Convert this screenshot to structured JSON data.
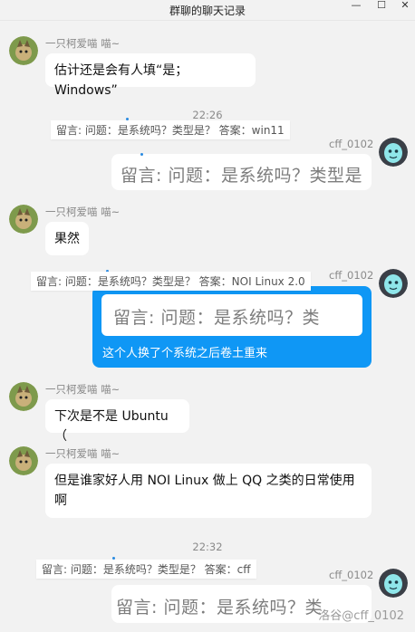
{
  "window": {
    "title": "群聊的聊天记录",
    "minimize_glyph": "—",
    "maximize_glyph": "☐",
    "close_glyph": "✕"
  },
  "users": {
    "cat_user": "一只柯爱喵 喵~",
    "cff_user": "cff_0102"
  },
  "messages": {
    "m1": "估计还是会有人填“是；Windows”",
    "time1": "22:26",
    "notice1": "留言: 问题：是系统吗？类型是？ 答案：win11",
    "m2_image_text": "留言: 问题：是系统吗？类型是",
    "m3": "果然",
    "notice2": "留言: 问题：是系统吗？类型是？ 答案：NOI Linux 2.0",
    "m4_image_text": "留言: 问题：是系统吗？类",
    "m4_caption": "这个人换了个系统之后卷土重来",
    "m5": "下次是不是 Ubuntu（",
    "m6": "但是谁家好人用 NOI Linux 做上 QQ 之类的日常使用啊",
    "time2": "22:32",
    "notice3": "留言: 问题：是系统吗？类型是？ 答案：cff",
    "m7_image_text": "留言: 问题：是系统吗？类"
  },
  "watermark": "洛谷@cff_0102",
  "colors": {
    "background": "#f2f2f2",
    "bubble": "#ffffff",
    "accent_blue": "#0f97f5",
    "muted_text": "#8a8a8a"
  },
  "icons": {
    "cat_avatar": "cat-avatar-icon",
    "cff_avatar": "ghost-avatar-icon"
  }
}
